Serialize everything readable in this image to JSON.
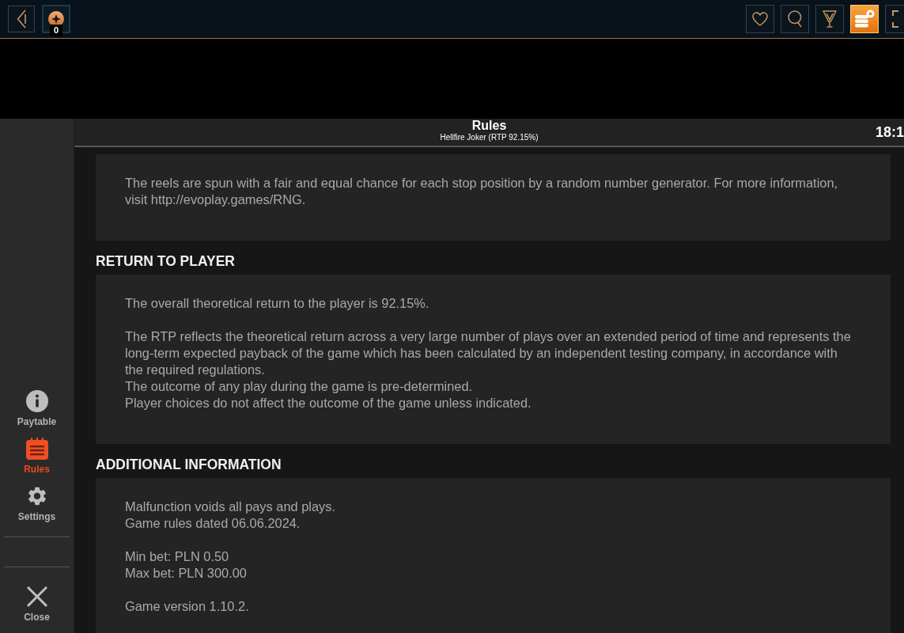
{
  "top_bar": {
    "balance_badge": "0",
    "buttons": [
      {
        "kind": "heart",
        "selected": false
      },
      {
        "kind": "search",
        "selected": false
      },
      {
        "kind": "trophy",
        "selected": false
      },
      {
        "kind": "coins",
        "selected": true
      },
      {
        "kind": "fullscreen",
        "selected": false
      }
    ]
  },
  "panel": {
    "title": "Rules",
    "subtitle": "Hellfire Joker (RTP 92.15%)",
    "time": "18:1",
    "sidebar": {
      "items": [
        {
          "kind": "info",
          "label": "Paytable",
          "selected": false
        },
        {
          "kind": "rules",
          "label": "Rules",
          "selected": true
        },
        {
          "kind": "settings",
          "label": "Settings",
          "selected": false
        }
      ],
      "close_label": "Close"
    },
    "sections": [
      {
        "blocks": [
          [
            "The reels are spun with a fair and equal chance for each stop position by a random number generator. For more information, visit http://evoplay.games/RNG."
          ]
        ]
      },
      {
        "heading": "RETURN TO PLAYER",
        "blocks": [
          [
            "The overall theoretical return to the player is 92.15%."
          ],
          [
            "The RTP reflects the theoretical return across a very large number of plays over an extended period of time and represents the long-term expected payback of the game which has been calculated by an independent testing company, in accordance with the required regulations.",
            "The outcome of any play during the game is pre-determined.",
            "Player choices do not affect the outcome of the game unless indicated."
          ]
        ]
      },
      {
        "heading": "ADDITIONAL INFORMATION",
        "blocks": [
          [
            "Malfunction voids all pays and plays.",
            "Game rules dated 06.06.2024."
          ],
          [
            "Min bet: PLN 0.50",
            "Max bet: PLN 300.00"
          ],
          [
            "Game version 1.10.2."
          ]
        ]
      }
    ]
  }
}
